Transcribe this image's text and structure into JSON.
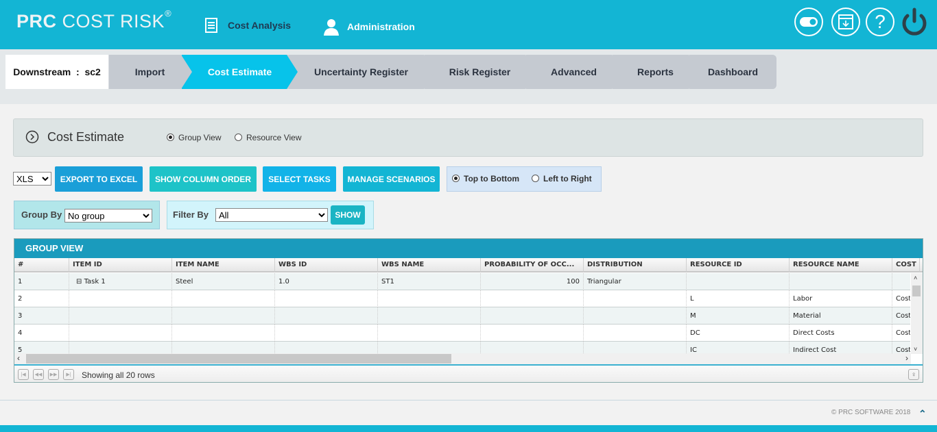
{
  "header": {
    "logo_bold": "PRC",
    "logo_rest": "COST RISK",
    "logo_mark": "®",
    "nav": [
      {
        "label": "Cost Analysis",
        "icon": "list-icon"
      },
      {
        "label": "Administration",
        "icon": "user-icon"
      }
    ],
    "icons": [
      "toggle-icon",
      "download-window-icon",
      "help-icon",
      "power-icon"
    ]
  },
  "breadcrumb": {
    "project": "Downstream",
    "scenario": "sc2",
    "steps": [
      "Import",
      "Cost Estimate",
      "Uncertainty Register",
      "Risk Register",
      "Advanced",
      "Reports",
      "Dashboard"
    ],
    "active": "Cost Estimate"
  },
  "panel": {
    "title": "Cost Estimate",
    "views": [
      "Group View",
      "Resource View"
    ],
    "selected_view": "Group View"
  },
  "toolbar": {
    "format": "XLS",
    "buttons": [
      "EXPORT TO EXCEL",
      "SHOW COLUMN ORDER",
      "SELECT TASKS",
      "MANAGE SCENARIOS"
    ],
    "orientation": [
      "Top to Bottom",
      "Left to Right"
    ],
    "selected_orientation": "Top to Bottom"
  },
  "filters": {
    "group_by_label": "Group By",
    "group_by_value": "No group",
    "filter_by_label": "Filter By",
    "filter_by_value": "All",
    "show_label": "SHOW"
  },
  "grid": {
    "title": "GROUP VIEW",
    "columns": [
      "#",
      "ITEM ID",
      "ITEM NAME",
      "WBS ID",
      "WBS NAME",
      "PROBABILITY OF OCC...",
      "DISTRIBUTION",
      "RESOURCE ID",
      "RESOURCE NAME",
      "COST U"
    ],
    "rows": [
      [
        "1",
        "Task 1",
        "Steel",
        "1.0",
        "ST1",
        "100",
        "Triangular",
        "",
        "",
        ""
      ],
      [
        "2",
        "",
        "",
        "",
        "",
        "",
        "",
        "L",
        "Labor",
        "Cost"
      ],
      [
        "3",
        "",
        "",
        "",
        "",
        "",
        "",
        "M",
        "Material",
        "Cost"
      ],
      [
        "4",
        "",
        "",
        "",
        "",
        "",
        "",
        "DC",
        "Direct Costs",
        "Cost"
      ],
      [
        "5",
        "",
        "",
        "",
        "",
        "",
        "",
        "IC",
        "Indirect Cost",
        "Cost"
      ]
    ],
    "status": "Showing all 20 rows"
  },
  "footer": {
    "copyright": "© PRC SOFTWARE 2018"
  },
  "colors": {
    "header": "#13b5d4",
    "active_step": "#07c3ea",
    "grid_title": "#1a9bbd"
  }
}
